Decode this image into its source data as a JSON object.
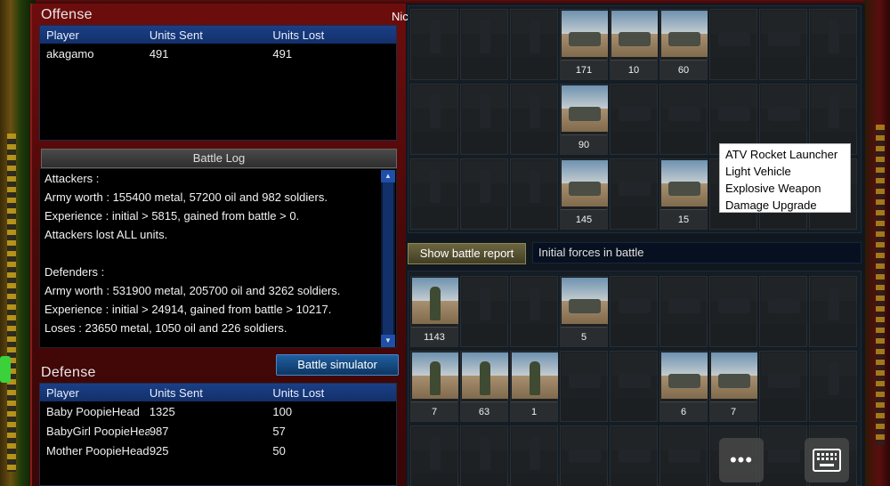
{
  "player_name": "Nicko",
  "offense": {
    "title": "Offense",
    "headers": [
      "Player",
      "Units Sent",
      "Units Lost"
    ],
    "rows": [
      {
        "player": "akagamo",
        "sent": "491",
        "lost": "491"
      }
    ]
  },
  "battle_log": {
    "title": "Battle Log",
    "lines": [
      "Attackers :",
      "Army worth : 155400 metal, 57200 oil and 982 soldiers.",
      "Experience : initial > 5815, gained from battle > 0.",
      "Attackers lost ALL units.",
      "",
      "Defenders :",
      "Army worth : 531900 metal, 205700 oil and 3262 soldiers.",
      "Experience : initial > 24914, gained from battle > 10217.",
      "Loses : 23650 metal, 1050 oil and 226 soldiers."
    ]
  },
  "battle_simulator_label": "Battle simulator",
  "defense": {
    "title": "Defense",
    "headers": [
      "Player",
      "Units Sent",
      "Units Lost"
    ],
    "rows": [
      {
        "player": "Baby PoopieHead",
        "sent": "1325",
        "lost": "100"
      },
      {
        "player": "BabyGirl PoopieHead",
        "sent": "987",
        "lost": "57"
      },
      {
        "player": "Mother PoopieHead",
        "sent": "925",
        "lost": "50"
      }
    ]
  },
  "attacker_units": {
    "row1": [
      "",
      "",
      "",
      "171",
      "10",
      "60",
      "",
      "",
      ""
    ],
    "row2": [
      "",
      "",
      "",
      "90",
      "",
      "",
      "",
      "",
      ""
    ],
    "row3": [
      "",
      "",
      "",
      "145",
      "",
      "15",
      "",
      "",
      ""
    ]
  },
  "tooltip": {
    "lines": [
      "ATV Rocket Launcher",
      "Light Vehicle",
      "Explosive Weapon",
      "Damage Upgrade"
    ]
  },
  "show_battle_report_label": "Show battle report",
  "initial_forces_label": "Initial forces in battle",
  "defender_units": {
    "row1": [
      "1143",
      "",
      "",
      "5",
      "",
      "",
      "",
      "",
      ""
    ],
    "row2": [
      "7",
      "63",
      "1",
      "",
      "",
      "6",
      "7",
      "",
      ""
    ],
    "row3": [
      "",
      "",
      "",
      "",
      "",
      "",
      "",
      "",
      ""
    ]
  },
  "icons": {
    "more": "more-dots-icon",
    "keyboard": "keyboard-icon"
  },
  "colors": {
    "panel_red": "#6d0d0d",
    "header_blue": "#1b3f86",
    "report_button": "#6c6640"
  }
}
